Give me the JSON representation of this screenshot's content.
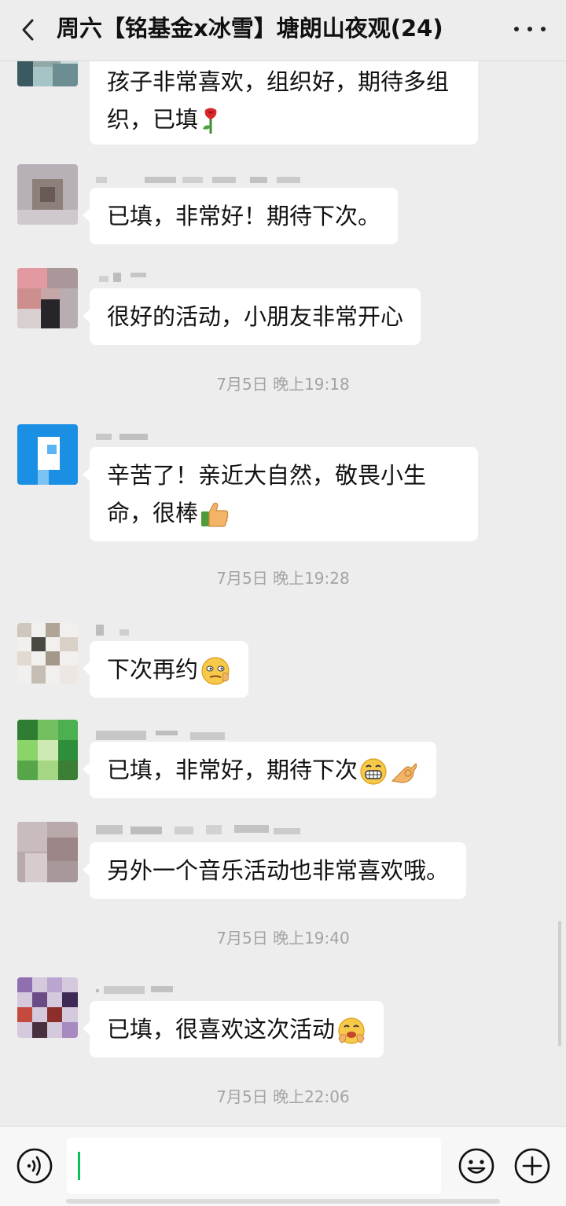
{
  "header": {
    "title": "周六【铭基金x冰雪】塘朗山夜观(24)",
    "back_icon": "chevron-left-icon",
    "more_icon": "more-dots-icon"
  },
  "messages": [
    {
      "text": "孩子非常喜欢，组织好，期待多组",
      "text2": "织，已填",
      "emoji": "rose"
    },
    {
      "text": "已填，非常好！期待下次。"
    },
    {
      "text": "很好的活动，小朋友非常开心"
    },
    {
      "text": "辛苦了！亲近大自然，敬畏小生",
      "text2": "命，很棒",
      "emoji": "thumbs-up"
    },
    {
      "text": "下次再约",
      "emoji": "smirk"
    },
    {
      "text": "已填，非常好，期待下次",
      "emoji": "grin-ok"
    },
    {
      "text": "另外一个音乐活动也非常喜欢哦。"
    },
    {
      "text": "已填，很喜欢这次活动",
      "emoji": "giggle"
    }
  ],
  "timestamps": [
    "7月5日 晚上19:18",
    "7月5日 晚上19:28",
    "7月5日 晚上19:40",
    "7月5日 晚上22:06"
  ],
  "input_bar": {
    "voice_icon": "voice-icon",
    "emoji_icon": "emoji-icon",
    "plus_icon": "plus-icon",
    "value": ""
  },
  "colors": {
    "background": "#ededed",
    "bubble": "#ffffff",
    "caret": "#07c160",
    "timestamp": "#a3a3a3"
  }
}
